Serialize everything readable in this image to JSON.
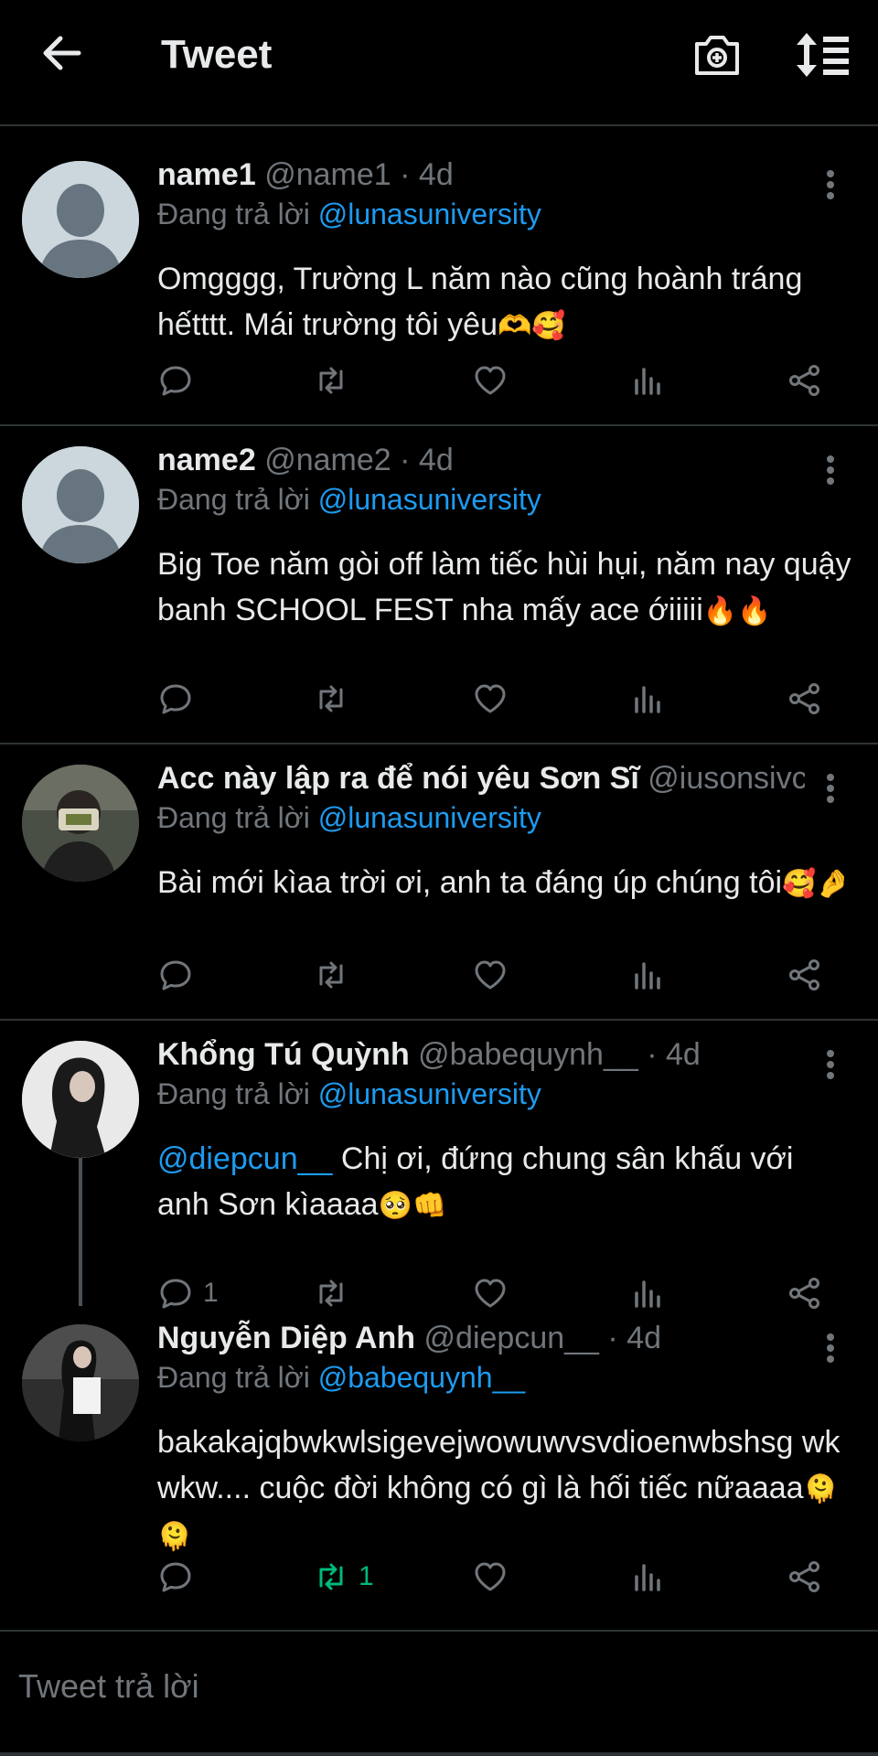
{
  "header": {
    "title": "Tweet",
    "back_icon": "arrow-left-icon",
    "camera_icon": "camera-plus-icon",
    "sort_icon": "sort-icon"
  },
  "colors": {
    "background": "#000000",
    "text": "#e7e9ea",
    "secondary": "#71767b",
    "link": "#1d9bf0",
    "retweet_active": "#00ba7c",
    "divider": "#2f3336"
  },
  "tweets": [
    {
      "name": "name1",
      "handle": "@name1",
      "dot": "·",
      "time": "4d",
      "reply_prefix": "Đang trả lời",
      "reply_to": "@lunasuniversity",
      "text_mention": "",
      "text": "Omgggg, Trường L năm nào cũng hoành tráng hếtttt. Mái trường tôi yêu",
      "emoji": "🫶🥰",
      "avatar": "default-avatar-icon",
      "reply_count": "",
      "retweet_count": ""
    },
    {
      "name": "name2",
      "handle": "@name2",
      "dot": "·",
      "time": "4d",
      "reply_prefix": "Đang trả lời",
      "reply_to": "@lunasuniversity",
      "text_mention": "",
      "text": "Big Toe năm gòi off làm tiếc hùi hụi, năm nay quậy banh SCHOOL FEST nha mấy ace ớiiiii",
      "emoji": "🔥🔥",
      "avatar": "default-avatar-icon",
      "reply_count": "",
      "retweet_count": ""
    },
    {
      "name": "Acc này lập ra để nói yêu Sơn Sĩ",
      "handle": "@iusonsivc...",
      "dot": "",
      "time": "",
      "reply_prefix": "Đang trả lời",
      "reply_to": "@lunasuniversity",
      "text_mention": "",
      "text": "Bài mới kìaa trời ơi, anh ta đáng úp chúng tôi",
      "emoji": "🥰🤌",
      "avatar": "photo-avatar",
      "reply_count": "",
      "retweet_count": ""
    },
    {
      "name": "Khổng Tú Quỳnh",
      "handle": "@babequynh__",
      "dot": "·",
      "time": "4d",
      "reply_prefix": "Đang trả lời",
      "reply_to": "@lunasuniversity",
      "text_mention": "@diepcun__",
      "text": " Chị ơi, đứng chung sân khấu với anh Sơn kìaaaa",
      "emoji": "🥺👊",
      "avatar": "photo-avatar",
      "reply_count": "1",
      "retweet_count": ""
    },
    {
      "name": "Nguyễn Diệp Anh",
      "handle": "@diepcun__",
      "dot": "·",
      "time": "4d",
      "reply_prefix": "Đang trả lời",
      "reply_to": "@babequynh__",
      "text_mention": "",
      "text": "bakakajqbwkwlsigevejwowuwvsvdioenwbshsg wkwkw.... cuộc đời không có gì là hối tiếc nữaaaa",
      "emoji": "🫠🫠",
      "avatar": "photo-avatar",
      "reply_count": "",
      "retweet_count": "1"
    }
  ],
  "compose": {
    "placeholder": "Tweet trả lời"
  }
}
